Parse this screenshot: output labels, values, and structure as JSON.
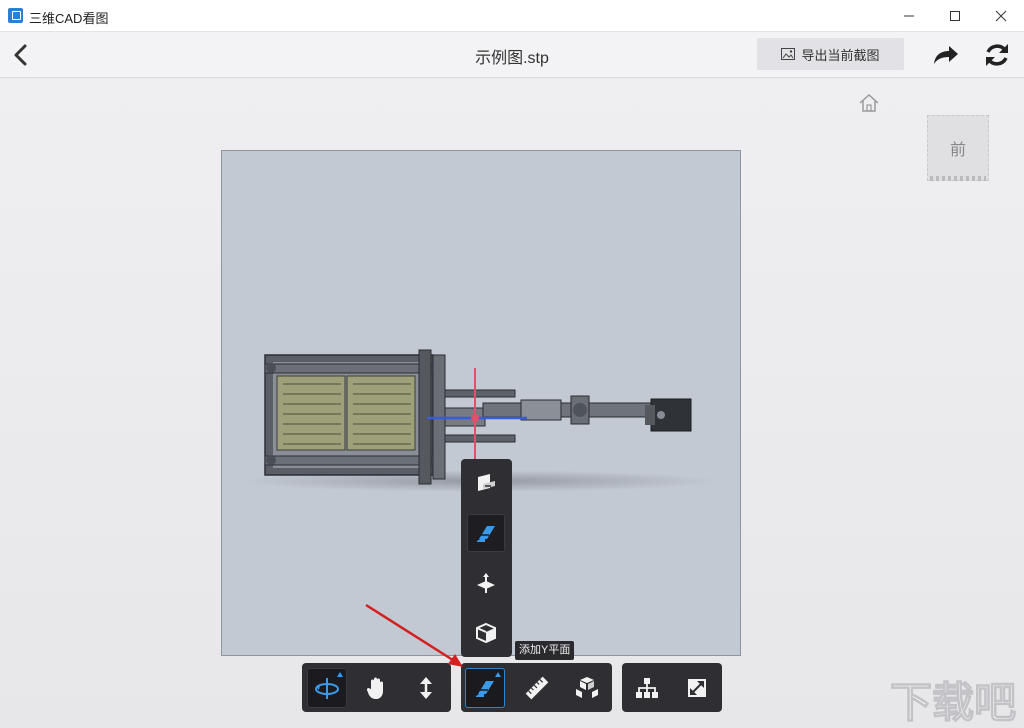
{
  "window": {
    "app_title": "三维CAD看图",
    "minimize_icon": "minimize-icon",
    "maximize_icon": "maximize-icon",
    "close_icon": "close-icon"
  },
  "toolbar": {
    "back_icon": "chevron-left-icon",
    "document_title": "示例图.stp",
    "export_button_label": "导出当前截图",
    "export_icon": "image-icon",
    "share_icon": "share-icon",
    "refresh_icon": "refresh-icon"
  },
  "viewport": {
    "home_icon": "home-icon",
    "viewcube_face": "前",
    "plane_color": "#c3c9d2",
    "axis_colors": {
      "x": "#3a5bd9",
      "y": "#e0506a"
    }
  },
  "section_flyout": {
    "items": [
      {
        "icon": "section-x-plane-icon",
        "active": false
      },
      {
        "icon": "section-y-plane-icon",
        "active": true
      },
      {
        "icon": "section-z-plane-icon",
        "active": false
      },
      {
        "icon": "section-box-icon",
        "active": false
      }
    ],
    "tooltip": "添加Y平面"
  },
  "bottom_toolbar": {
    "groups": [
      {
        "tools": [
          "rotate-icon",
          "pan-hand-icon",
          "zoom-vertical-icon"
        ],
        "active": "rotate-icon"
      },
      {
        "tools": [
          "section-plane-icon",
          "measure-ruler-icon",
          "explode-cubes-icon"
        ],
        "active": "section-plane-icon"
      },
      {
        "tools": [
          "structure-tree-icon",
          "fullscreen-icon"
        ],
        "active": null
      }
    ]
  },
  "accent_color": "#2a86d4",
  "watermark_text": "下载吧"
}
